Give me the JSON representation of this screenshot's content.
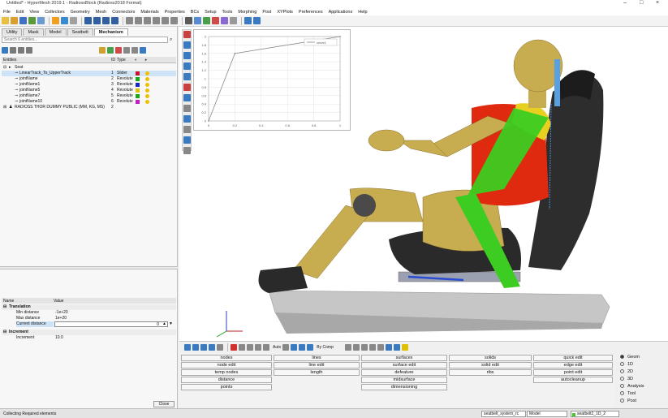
{
  "window": {
    "title": "Untitled* - HyperMesh 2019.1 - RadiossBlock (Radioss2018 Format)"
  },
  "menu": [
    "File",
    "Edit",
    "View",
    "Collectors",
    "Geometry",
    "Mesh",
    "Connectors",
    "Materials",
    "Properties",
    "BCs",
    "Setup",
    "Tools",
    "Morphing",
    "Post",
    "XYPlots",
    "Preferences",
    "Applications",
    "Help"
  ],
  "tabs": [
    "Utility",
    "Mask",
    "Model",
    "Seatbelt",
    "Mechanism"
  ],
  "active_tab": "Mechanism",
  "search": {
    "placeholder": "Search 6 entities..."
  },
  "entities": {
    "header": {
      "entities": "Entities",
      "id": "ID",
      "type": "Type"
    },
    "rows": [
      {
        "name": "Seat",
        "id": "",
        "type": "",
        "swatch": ""
      },
      {
        "name": "LinearTrack_To_UpperTrack",
        "id": "1",
        "type": "Slider",
        "swatch": "#d0102a"
      },
      {
        "name": "jointName",
        "id": "2",
        "type": "Revolute",
        "swatch": "#18a818"
      },
      {
        "name": "jointName1",
        "id": "3",
        "type": "Revolute",
        "swatch": "#1428c8"
      },
      {
        "name": "jointName5",
        "id": "4",
        "type": "Revolute",
        "swatch": "#e0c000"
      },
      {
        "name": "jointName7",
        "id": "5",
        "type": "Revolute",
        "swatch": "#18a818"
      },
      {
        "name": "jointName10",
        "id": "6",
        "type": "Revolute",
        "swatch": "#c020c0"
      },
      {
        "name": "RADIOSS THOR DUMMY PUBLIC (MM, KG, MS)",
        "id": "2",
        "type": "",
        "swatch": ""
      }
    ]
  },
  "properties": {
    "header": {
      "name": "Name",
      "value": "Value"
    },
    "translation": "Translation",
    "min_distance": {
      "label": "Min distance",
      "value": "-1e+20"
    },
    "max_distance": {
      "label": "Max distance",
      "value": "1e+20"
    },
    "current_distance": {
      "label": "Current distance",
      "value": "0"
    },
    "increment_group": "Increment",
    "increment": {
      "label": "Increment",
      "value": "10.0"
    }
  },
  "close_label": "Close",
  "plot": {
    "legend": "curve1",
    "chart_data": {
      "type": "line",
      "x": [
        0,
        0.2,
        1.0
      ],
      "y": [
        0,
        1.6,
        2.0
      ],
      "xticks": [
        "0",
        "0.2",
        "0.4",
        "0.6",
        "0.8",
        "1"
      ],
      "yticks": [
        "0",
        "0.2",
        "0.4",
        "0.6",
        "0.8",
        "1",
        "1.2",
        "1.4",
        "1.6",
        "1.8",
        "2"
      ],
      "xlim": [
        0,
        1
      ],
      "ylim": [
        0,
        2
      ],
      "grid": true,
      "legend_position": "top-right"
    }
  },
  "bottom_toolbar": {
    "auto": "Auto",
    "by_comp": "By Comp"
  },
  "panel_buttons": {
    "col1": [
      "nodes",
      "node edit",
      "temp nodes",
      "distance",
      "points"
    ],
    "col2": [
      "lines",
      "line edit",
      "length"
    ],
    "col3": [
      "surfaces",
      "surface edit",
      "defeature",
      "midsurface",
      "dimensioning"
    ],
    "col4": [
      "solids",
      "solid edit",
      "ribs"
    ],
    "col5": [
      "quick edit",
      "edge edit",
      "point edit",
      "autocleanup"
    ]
  },
  "radios": [
    "Geom",
    "1D",
    "2D",
    "3D",
    "Analysis",
    "Tool",
    "Post"
  ],
  "radio_selected": "Geom",
  "status": {
    "text": "Collecting Required elements",
    "box1": "seatbelt_system_rc",
    "box2": "Model",
    "box3": "seatbelt2_1D_2"
  },
  "colors": {
    "dummy_skin": "#c8ad50",
    "vest": "#e02a10",
    "belt": "#3ccc22",
    "seat": "#2a2a2a",
    "floor": "#c4c4c4"
  }
}
